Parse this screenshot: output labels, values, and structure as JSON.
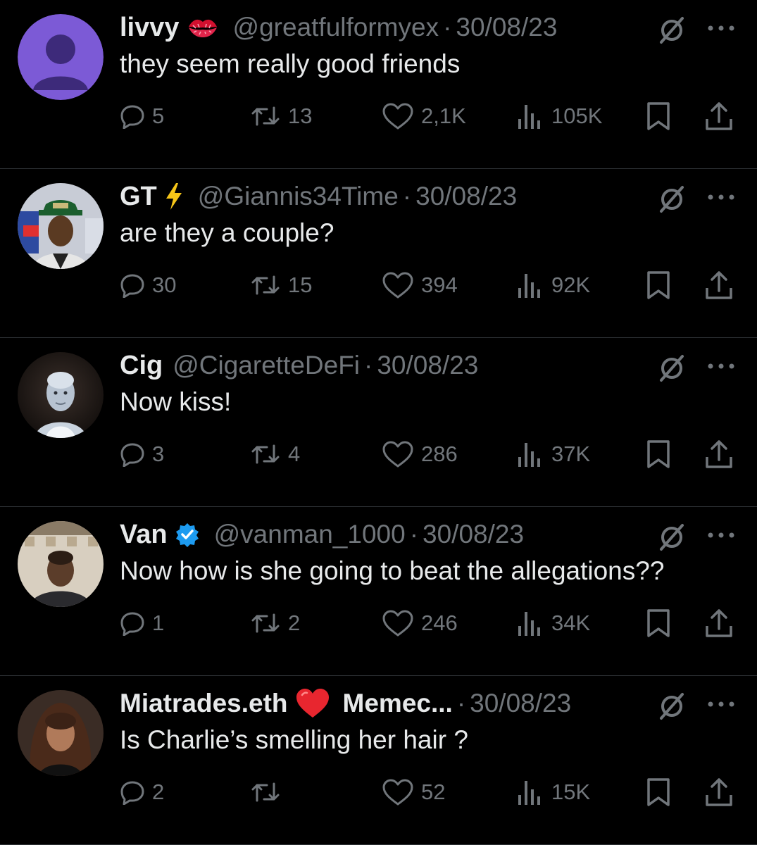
{
  "colors": {
    "background": "#000000",
    "text_primary": "#e7e9ea",
    "text_secondary": "#71767b",
    "divider": "#2f3336",
    "verified": "#1d9bf0",
    "heart": "#e0245e"
  },
  "tweets": [
    {
      "name": "livvy",
      "name_emoji": "kiss-mark-icon",
      "handle": "@greatfulformyex",
      "date": "30/08/23",
      "text": "they seem really good friends",
      "replies": "5",
      "retweets": "13",
      "likes": "2,1K",
      "views": "105K"
    },
    {
      "name": "GT",
      "name_emoji": "lightning-icon",
      "handle": "@Giannis34Time",
      "date": "30/08/23",
      "text": "are they a couple?",
      "replies": "30",
      "retweets": "15",
      "likes": "394",
      "views": "92K"
    },
    {
      "name": "Cig",
      "handle": "@CigaretteDeFi",
      "date": "30/08/23",
      "text": "Now kiss!",
      "replies": "3",
      "retweets": "4",
      "likes": "286",
      "views": "37K"
    },
    {
      "name": "Van",
      "name_emoji": "verified-badge-icon",
      "handle": "@vanman_1000",
      "date": "30/08/23",
      "text": "Now how is she going to beat the allegations??",
      "replies": "1",
      "retweets": "2",
      "likes": "246",
      "views": "34K"
    },
    {
      "name": "Miatrades.eth",
      "name_emoji": "red-heart-icon",
      "name_suffix": "Memec...",
      "date": "30/08/23",
      "text": "Is Charlie’s smelling her hair ?",
      "replies": "2",
      "retweets": "",
      "likes": "52",
      "views": "15K"
    }
  ],
  "separator": "·"
}
